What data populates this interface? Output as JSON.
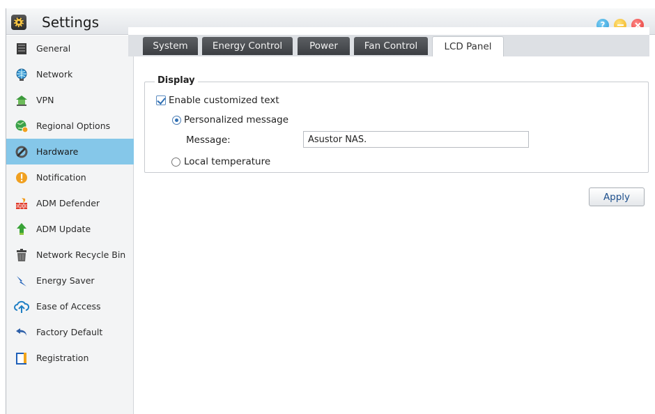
{
  "window": {
    "title": "Settings"
  },
  "title_buttons": {
    "help_glyph": "?"
  },
  "sidebar": {
    "items": [
      {
        "label": "General",
        "icon": "server-icon"
      },
      {
        "label": "Network",
        "icon": "globe-icon"
      },
      {
        "label": "VPN",
        "icon": "house-network-icon"
      },
      {
        "label": "Regional Options",
        "icon": "earth-icon"
      },
      {
        "label": "Hardware",
        "icon": "wrench-icon",
        "active": true
      },
      {
        "label": "Notification",
        "icon": "alert-icon"
      },
      {
        "label": "ADM Defender",
        "icon": "firewall-icon"
      },
      {
        "label": "ADM Update",
        "icon": "up-arrow-icon"
      },
      {
        "label": "Network Recycle Bin",
        "icon": "trash-icon"
      },
      {
        "label": "Energy Saver",
        "icon": "lightning-icon"
      },
      {
        "label": "Ease of Access",
        "icon": "cloud-upload-icon"
      },
      {
        "label": "Factory Default",
        "icon": "undo-icon"
      },
      {
        "label": "Registration",
        "icon": "clipboard-icon"
      }
    ]
  },
  "tabs": [
    {
      "label": "System"
    },
    {
      "label": "Energy Control"
    },
    {
      "label": "Power"
    },
    {
      "label": "Fan Control"
    },
    {
      "label": "LCD Panel",
      "active": true
    }
  ],
  "display": {
    "legend": "Display",
    "enable_label": "Enable customized text",
    "enable_checked": true,
    "personalized_label": "Personalized message",
    "message_label": "Message:",
    "message_value": "Asustor NAS.",
    "local_temp_label": "Local temperature",
    "selected_option": "Personalized message"
  },
  "actions": {
    "apply_label": "Apply"
  },
  "colors": {
    "active_nav": "#85c7e9",
    "tab_dark": "#4a4d51",
    "accent": "#2f6fb3"
  }
}
